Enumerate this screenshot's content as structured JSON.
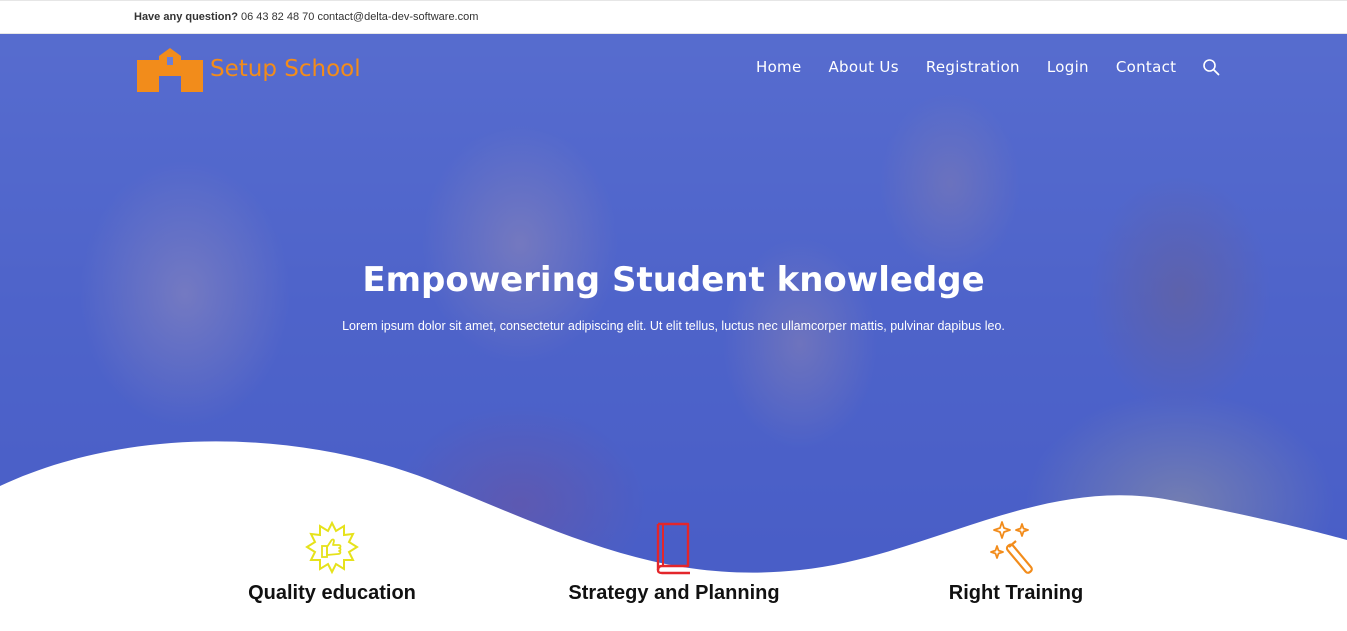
{
  "topbar": {
    "question_label": "Have any question?",
    "contact_info": "06 43 82 48 70 contact@delta-dev-software.com"
  },
  "brand": {
    "name": "Setup School",
    "logo_icon": "school-building-icon",
    "color": "#f28c1b"
  },
  "nav": {
    "items": [
      "Home",
      "About Us",
      "Registration",
      "Login",
      "Contact"
    ],
    "search_icon": "search-icon"
  },
  "hero": {
    "title": "Empowering Student knowledge",
    "subtitle": "Lorem ipsum dolor sit amet, consectetur adipiscing elit. Ut elit tellus, luctus nec ullamcorper mattis, pulvinar dapibus leo.",
    "overlay_color": "#4f63c9"
  },
  "features": [
    {
      "label": "Quality education",
      "icon": "award-thumbs-up-icon",
      "color": "#e6e21b"
    },
    {
      "label": "Strategy and Planning",
      "icon": "book-icon",
      "color": "#e3262b"
    },
    {
      "label": "Right Training",
      "icon": "magic-wand-icon",
      "color": "#f28c1b"
    }
  ]
}
